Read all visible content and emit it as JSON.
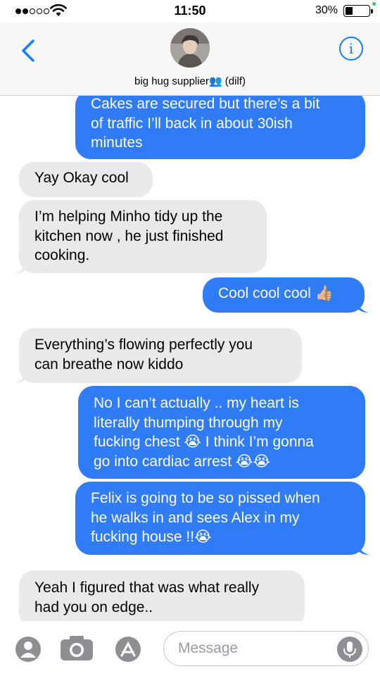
{
  "status_bar": {
    "time": "11:50",
    "battery_percent": "30%",
    "battery_level": 0.3,
    "signal_bars_filled": 2,
    "signal_bars_total": 5
  },
  "header": {
    "contact_name": "big hug supplier👥 (dilf)",
    "info_icon": "i",
    "accent_color": "#147efb"
  },
  "messages": [
    {
      "direction": "outgoing",
      "text": "Cakes are secured but there’s a bit\nof traffic I’ll back in about 30ish\nminutes"
    },
    {
      "direction": "incoming",
      "text": "Yay Okay cool"
    },
    {
      "direction": "incoming",
      "text": "I’m helping Minho tidy up the\nkitchen now , he just finished\ncooking."
    },
    {
      "direction": "outgoing",
      "text": "Cool cool cool 👍🏼"
    },
    {
      "direction": "incoming",
      "text": "Everything’s flowing perfectly you\ncan breathe now kiddo"
    },
    {
      "direction": "outgoing",
      "text": "No I can’t actually .. my heart is\nliterally thumping through my\nfucking chest 😭 I think I’m gonna\ngo into cardiac arrest 😭😭"
    },
    {
      "direction": "outgoing",
      "text": "Felix is going to be so pissed when\nhe walks in and sees Alex in my\nfucking house !!😭"
    },
    {
      "direction": "incoming",
      "text": "Yeah I figured that was what really\nhad you on edge.."
    }
  ],
  "input_bar": {
    "placeholder": "Message",
    "icons": [
      "memoji-icon",
      "camera-icon",
      "app-store-icon",
      "microphone-icon"
    ]
  },
  "colors": {
    "outgoing_bubble": "#2f7cf6",
    "incoming_bubble": "#e9e9eb"
  }
}
